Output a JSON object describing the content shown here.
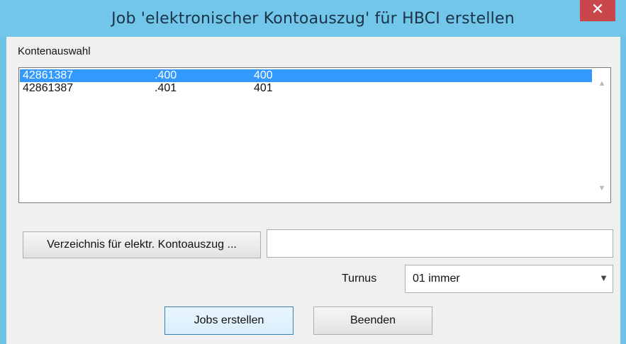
{
  "window": {
    "title": "Job 'elektronischer Kontoauszug' für HBCI erstellen",
    "close_glyph": "✕"
  },
  "accounts": {
    "label": "Kontenauswahl",
    "rows": [
      {
        "account": "42861387",
        "sub": ".400",
        "code": "400",
        "selected": true
      },
      {
        "account": "42861387",
        "sub": ".401",
        "code": "401",
        "selected": false
      }
    ]
  },
  "directory": {
    "button_label": "Verzeichnis für elektr. Kontoauszug ...",
    "path_value": ""
  },
  "turnus": {
    "label": "Turnus",
    "selected": "01 immer"
  },
  "actions": {
    "create_label": "Jobs erstellen",
    "exit_label": "Beenden"
  },
  "colors": {
    "titlebar": "#72c6ea",
    "close": "#c9474a",
    "selection": "#3399ff"
  }
}
